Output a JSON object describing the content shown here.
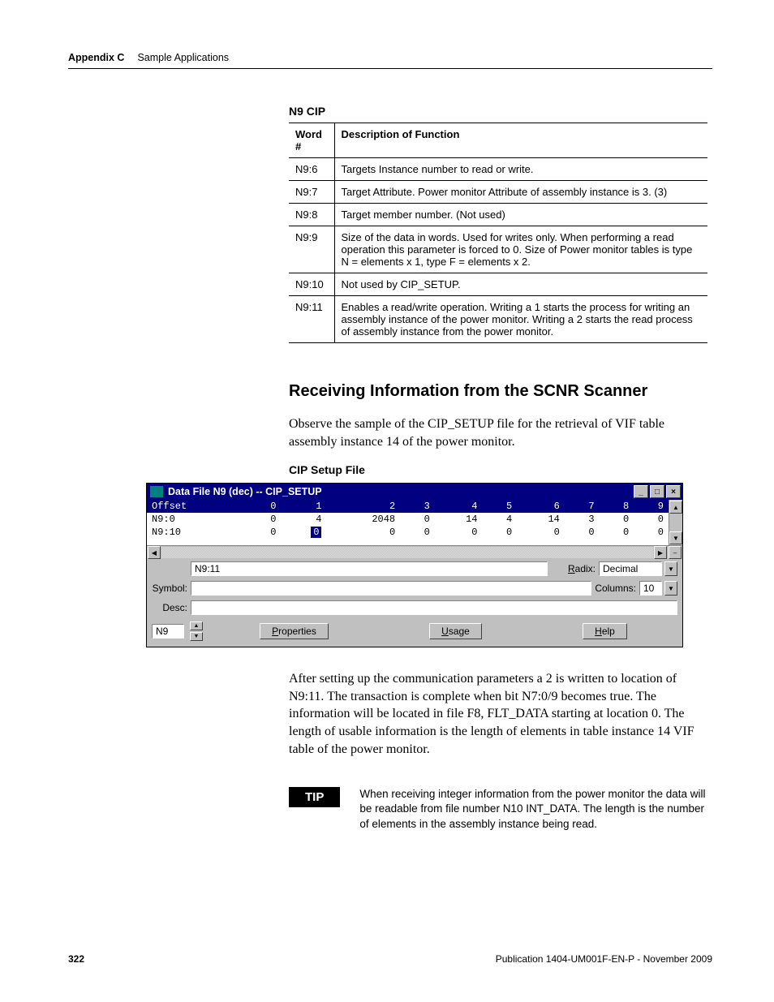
{
  "header": {
    "appendix": "Appendix C",
    "section": "Sample Applications"
  },
  "table": {
    "caption": "N9 CIP",
    "head_word": "Word #",
    "head_desc": "Description of Function",
    "rows": [
      {
        "w": "N9:6",
        "d": "Targets Instance number to read or write."
      },
      {
        "w": "N9:7",
        "d": "Target Attribute. Power monitor Attribute of assembly instance is 3. (3)"
      },
      {
        "w": "N9:8",
        "d": "Target member number. (Not used)"
      },
      {
        "w": "N9:9",
        "d": "Size of the data in words.  Used for writes only.  When performing a read operation this parameter is forced to 0.  Size of Power monitor tables is type N = elements x 1, type F = elements x 2."
      },
      {
        "w": "N9:10",
        "d": "Not used by CIP_SETUP."
      },
      {
        "w": "N9:11",
        "d": "Enables a read/write operation.  Writing a 1 starts the process for writing an assembly instance of the power monitor. Writing a 2 starts the read process of assembly instance from the power monitor."
      }
    ]
  },
  "subhead": "Receiving Information from the SCNR Scanner",
  "para1": "Observe the sample of the CIP_SETUP file for the retrieval of  VIF table assembly instance 14 of the power monitor.",
  "fig_caption": "CIP Setup File",
  "win": {
    "title": "Data File N9 (dec)  --  CIP_SETUP",
    "cols": [
      "Offset",
      "0",
      "1",
      "2",
      "3",
      "4",
      "5",
      "6",
      "7",
      "8",
      "9"
    ],
    "rows": [
      {
        "label": "N9:0",
        "v": [
          "0",
          "4",
          "2048",
          "0",
          "14",
          "4",
          "14",
          "3",
          "0",
          "0"
        ]
      },
      {
        "label": "N9:10",
        "v": [
          "0",
          "0",
          "0",
          "0",
          "0",
          "0",
          "0",
          "0",
          "0",
          "0"
        ]
      }
    ],
    "selected_row": 1,
    "selected_col": 1,
    "addr_label": "",
    "addr_value": "N9:11",
    "radix_label": "Radix:",
    "radix_value": "Decimal",
    "symbol_label": "Symbol:",
    "symbol_value": "",
    "columns_label": "Columns:",
    "columns_value": "10",
    "desc_label": "Desc:",
    "desc_value": "",
    "file_field": "N9",
    "btn_properties": "Properties",
    "btn_usage": "Usage",
    "btn_help": "Help"
  },
  "para2": "After setting up the communication parameters a 2 is written to location of  N9:11.  The transaction is complete when bit N7:0/9 becomes true.  The information will be located in file F8, FLT_DATA starting at location 0.  The length of usable information is the length of elements in table instance 14 VIF table of the power monitor.",
  "tip": {
    "badge": "TIP",
    "text": "When receiving integer information from the power monitor the data will be readable from file number N10 INT_DATA.  The length is the number of elements in the assembly instance being read."
  },
  "footer": {
    "page": "322",
    "pub": "Publication 1404-UM001F-EN-P - November 2009"
  }
}
